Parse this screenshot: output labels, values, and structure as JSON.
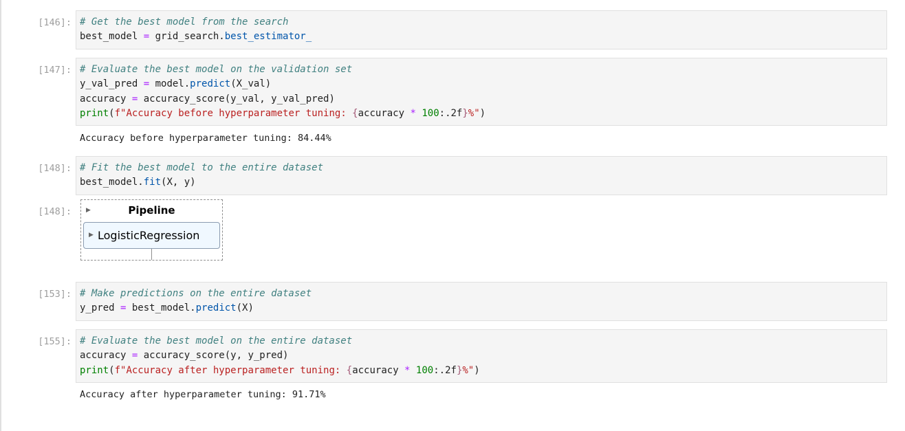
{
  "cells": [
    {
      "prompt": "[146]:",
      "lines": [
        [
          {
            "t": "# Get the best model from the search",
            "c": "comment"
          }
        ],
        [
          {
            "t": "best_model ",
            "c": "plain"
          },
          {
            "t": "=",
            "c": "op"
          },
          {
            "t": " grid_search.",
            "c": "plain"
          },
          {
            "t": "best_estimator_",
            "c": "attr"
          }
        ]
      ]
    },
    {
      "prompt": "[147]:",
      "lines": [
        [
          {
            "t": "# Evaluate the best model on the validation set",
            "c": "comment"
          }
        ],
        [
          {
            "t": "y_val_pred ",
            "c": "plain"
          },
          {
            "t": "=",
            "c": "op"
          },
          {
            "t": " model.",
            "c": "plain"
          },
          {
            "t": "predict",
            "c": "attr"
          },
          {
            "t": "(X_val)",
            "c": "plain"
          }
        ],
        [
          {
            "t": "accuracy ",
            "c": "plain"
          },
          {
            "t": "=",
            "c": "op"
          },
          {
            "t": " accuracy_score(y_val, y_val_pred)",
            "c": "plain"
          }
        ],
        [
          {
            "t": "print",
            "c": "builtin"
          },
          {
            "t": "(",
            "c": "plain"
          },
          {
            "t": "f\"Accuracy before hyperparameter tuning: ",
            "c": "string"
          },
          {
            "t": "{",
            "c": "interp"
          },
          {
            "t": "accuracy ",
            "c": "plain"
          },
          {
            "t": "*",
            "c": "op"
          },
          {
            "t": " ",
            "c": "plain"
          },
          {
            "t": "100",
            "c": "num"
          },
          {
            "t": ":.2f",
            "c": "plain"
          },
          {
            "t": "}",
            "c": "interp"
          },
          {
            "t": "%\"",
            "c": "string"
          },
          {
            "t": ")",
            "c": "plain"
          }
        ]
      ],
      "output": "Accuracy before hyperparameter tuning: 84.44%"
    },
    {
      "prompt": "[148]:",
      "lines": [
        [
          {
            "t": "# Fit the best model to the entire dataset",
            "c": "comment"
          }
        ],
        [
          {
            "t": "best_model.",
            "c": "plain"
          },
          {
            "t": "fit",
            "c": "attr"
          },
          {
            "t": "(X, y)",
            "c": "plain"
          }
        ]
      ]
    },
    {
      "prompt": "[153]:",
      "lines": [
        [
          {
            "t": "# Make predictions on the entire dataset",
            "c": "comment"
          }
        ],
        [
          {
            "t": "y_pred ",
            "c": "plain"
          },
          {
            "t": "=",
            "c": "op"
          },
          {
            "t": " best_model.",
            "c": "plain"
          },
          {
            "t": "predict",
            "c": "attr"
          },
          {
            "t": "(X)",
            "c": "plain"
          }
        ]
      ]
    },
    {
      "prompt": "[155]:",
      "lines": [
        [
          {
            "t": "# Evaluate the best model on the entire dataset",
            "c": "comment"
          }
        ],
        [
          {
            "t": "accuracy ",
            "c": "plain"
          },
          {
            "t": "=",
            "c": "op"
          },
          {
            "t": " accuracy_score(y, y_pred)",
            "c": "plain"
          }
        ],
        [
          {
            "t": "print",
            "c": "builtin"
          },
          {
            "t": "(",
            "c": "plain"
          },
          {
            "t": "f\"Accuracy after hyperparameter tuning: ",
            "c": "string"
          },
          {
            "t": "{",
            "c": "interp"
          },
          {
            "t": "accuracy ",
            "c": "plain"
          },
          {
            "t": "*",
            "c": "op"
          },
          {
            "t": " ",
            "c": "plain"
          },
          {
            "t": "100",
            "c": "num"
          },
          {
            "t": ":.2f",
            "c": "plain"
          },
          {
            "t": "}",
            "c": "interp"
          },
          {
            "t": "%\"",
            "c": "string"
          },
          {
            "t": ")",
            "c": "plain"
          }
        ]
      ],
      "output": "Accuracy after hyperparameter tuning: 91.71%"
    }
  ],
  "pipeline_output": {
    "prompt": "[148]:",
    "title": "Pipeline",
    "title_toggle_icon": "triangle-right-icon",
    "estimator_label": "LogisticRegression",
    "estimator_toggle_icon": "triangle-right-icon"
  }
}
